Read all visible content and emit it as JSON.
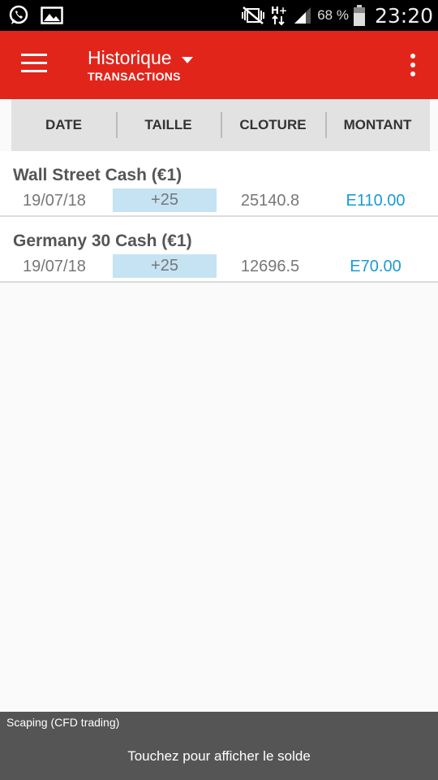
{
  "status_bar": {
    "icons_left": [
      "whatsapp-icon",
      "image-icon"
    ],
    "icons_right": [
      "mute-vibrate-icon",
      "hplus-data-icon",
      "signal-icon"
    ],
    "battery": "68 %",
    "time": "23:20"
  },
  "app_bar": {
    "title": "Historique",
    "subtitle": "TRANSACTIONS",
    "color": "#e1251b"
  },
  "columns": [
    "DATE",
    "TAILLE",
    "CLOTURE",
    "MONTANT"
  ],
  "transactions": [
    {
      "name": "Wall Street Cash (€1)",
      "date": "19/07/18",
      "size": "+25",
      "close": "25140.8",
      "amount": "E110.00"
    },
    {
      "name": "Germany 30 Cash (€1)",
      "date": "19/07/18",
      "size": "+25",
      "close": "12696.5",
      "amount": "E70.00"
    }
  ],
  "footer": {
    "account": "Scaping (CFD trading)",
    "tap_hint": "Touchez pour afficher le solde"
  },
  "colors": {
    "amount": "#1a9ad6",
    "size_highlight": "#c5e3f3"
  }
}
